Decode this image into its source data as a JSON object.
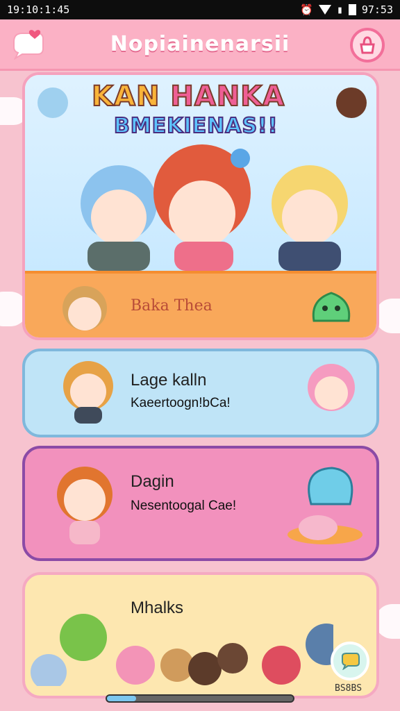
{
  "status_bar": {
    "left_text": "19:10:1:45",
    "time": "97:53"
  },
  "header": {
    "title": "Nopiainenarsii"
  },
  "hero": {
    "title_line1a": "KAN",
    "title_line1b": "HANKA",
    "title_line2": "BMEKIENAS!!",
    "strip_label": "Baka Thea"
  },
  "cards": [
    {
      "title": "Lage kalln",
      "subtitle": "Kaeertoogn!bCa!"
    },
    {
      "title": "Dagin",
      "subtitle": "Nesentoogal Cae!"
    },
    {
      "title": "Mhalks",
      "subtitle": ""
    }
  ],
  "corner_label": "BS8BS",
  "colors": {
    "accent_pink": "#f26f9a",
    "header_bg": "#fbb1c5",
    "card_blue": "#bfe4f7",
    "card_pink": "#f291bd",
    "card_yellow": "#fde7b0"
  }
}
